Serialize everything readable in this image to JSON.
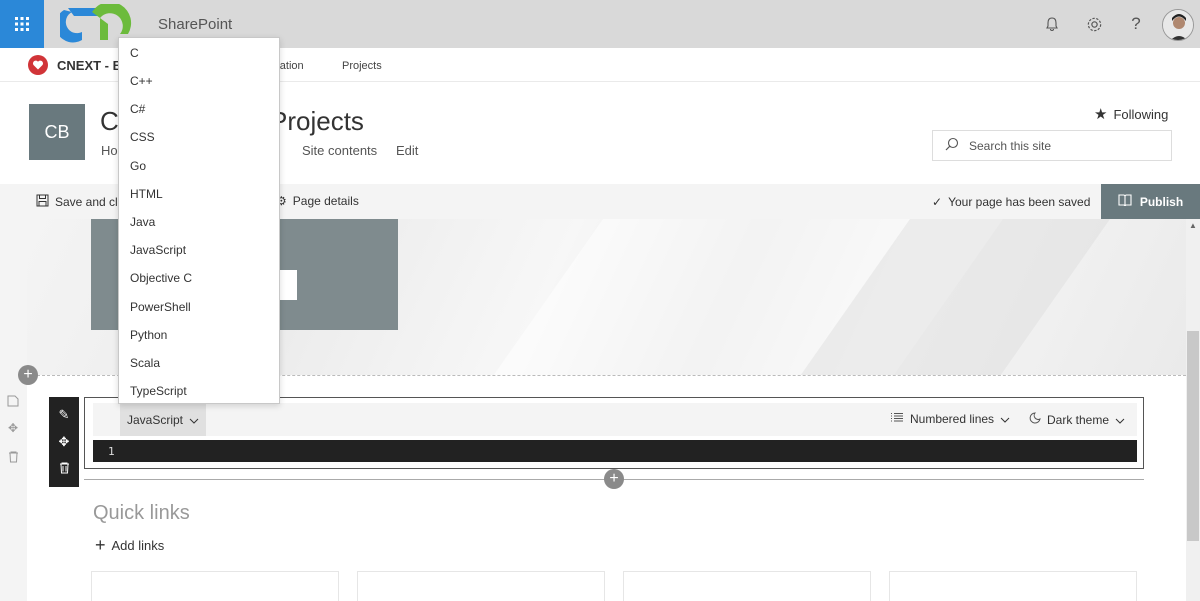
{
  "suite": {
    "app_name": "SharePoint",
    "icons": [
      "waffle-icon",
      "bell-icon",
      "gear-icon",
      "help-icon"
    ]
  },
  "hub": {
    "title": "CNEXT - Bo",
    "links": [
      "oration",
      "Projects"
    ]
  },
  "site": {
    "logo_text": "CB",
    "title_left": "CN",
    "title_right": "Projects",
    "nav": [
      "Hor",
      "Site contents",
      "Edit"
    ],
    "following_label": "Following",
    "search_placeholder": "Search this site"
  },
  "command_bar": {
    "save_label": "Save and clo",
    "page_details_label": "Page details",
    "saved_message": "Your page has been saved",
    "publish_label": "Publish"
  },
  "code_web_part": {
    "language": "JavaScript",
    "line_option": "Numbered lines",
    "theme_option": "Dark theme",
    "line_number": "1"
  },
  "language_dropdown": {
    "options": [
      "C",
      "C++",
      "C#",
      "CSS",
      "Go",
      "HTML",
      "Java",
      "JavaScript",
      "Objective C",
      "PowerShell",
      "Python",
      "Scala",
      "TypeScript"
    ]
  },
  "quick_links": {
    "title": "Quick links",
    "add_label": "Add links"
  },
  "colors": {
    "waffle": "#2b88d8",
    "publish": "#69797e",
    "site_logo": "#69797e",
    "hub_logo": "#d13438"
  }
}
